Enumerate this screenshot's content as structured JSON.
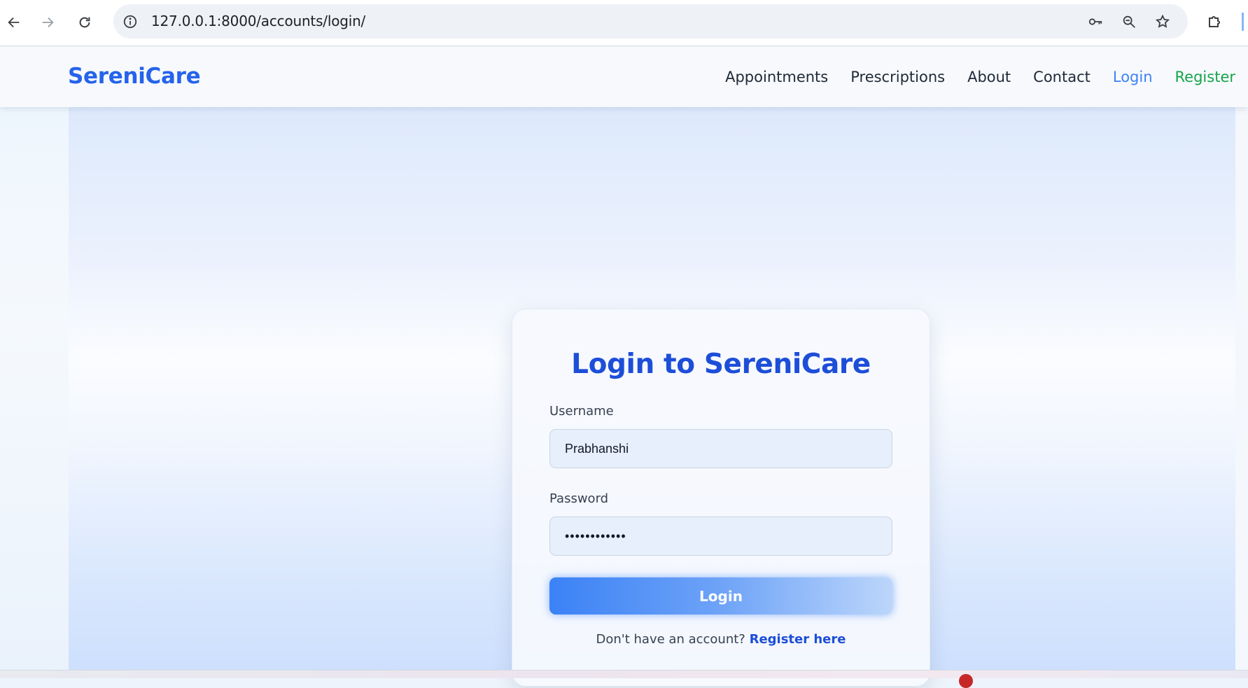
{
  "browser": {
    "url": "127.0.0.1:8000/accounts/login/",
    "icons": [
      "back-arrow-icon",
      "forward-arrow-icon",
      "reload-icon",
      "site-info-icon",
      "key-icon",
      "zoom-icon",
      "star-icon",
      "extensions-icon"
    ]
  },
  "header": {
    "brand": "SereniCare",
    "nav": {
      "appointments": "Appointments",
      "prescriptions": "Prescriptions",
      "about": "About",
      "contact": "Contact",
      "login": "Login",
      "register": "Register"
    }
  },
  "login_form": {
    "title": "Login to SereniCare",
    "username_label": "Username",
    "username_value": "Prabhanshi",
    "password_label": "Password",
    "password_value": "••••••••••••",
    "submit_label": "Login",
    "register_prompt": "Don't have an account?",
    "register_link": "Register here"
  },
  "colors": {
    "brand": "#2563eb",
    "title": "#1d4ed8",
    "login_nav": "#3b82f6",
    "register_nav": "#16a34a",
    "button_start": "#3b82f6",
    "button_end": "#bcd6fb"
  }
}
